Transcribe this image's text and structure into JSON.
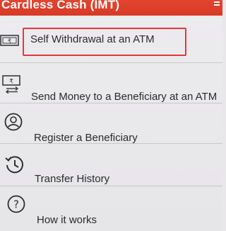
{
  "header": {
    "title": "Cardless Cash (IMT)",
    "menu_icon": "more-menu-icon",
    "background_color": "#e2442f"
  },
  "items": [
    {
      "label": "Self Withdrawal at an ATM",
      "icon": "cash-note-icon",
      "highlighted": true
    },
    {
      "label": "Send Money to a Beneficiary at an ATM",
      "icon": "money-transfer-icon"
    },
    {
      "label": "Register a Beneficiary",
      "icon": "user-circle-icon"
    },
    {
      "label": "Transfer History",
      "icon": "history-clock-icon"
    },
    {
      "label": "How it works",
      "icon": "help-circle-icon"
    }
  ],
  "highlight_color": "#e5383b"
}
